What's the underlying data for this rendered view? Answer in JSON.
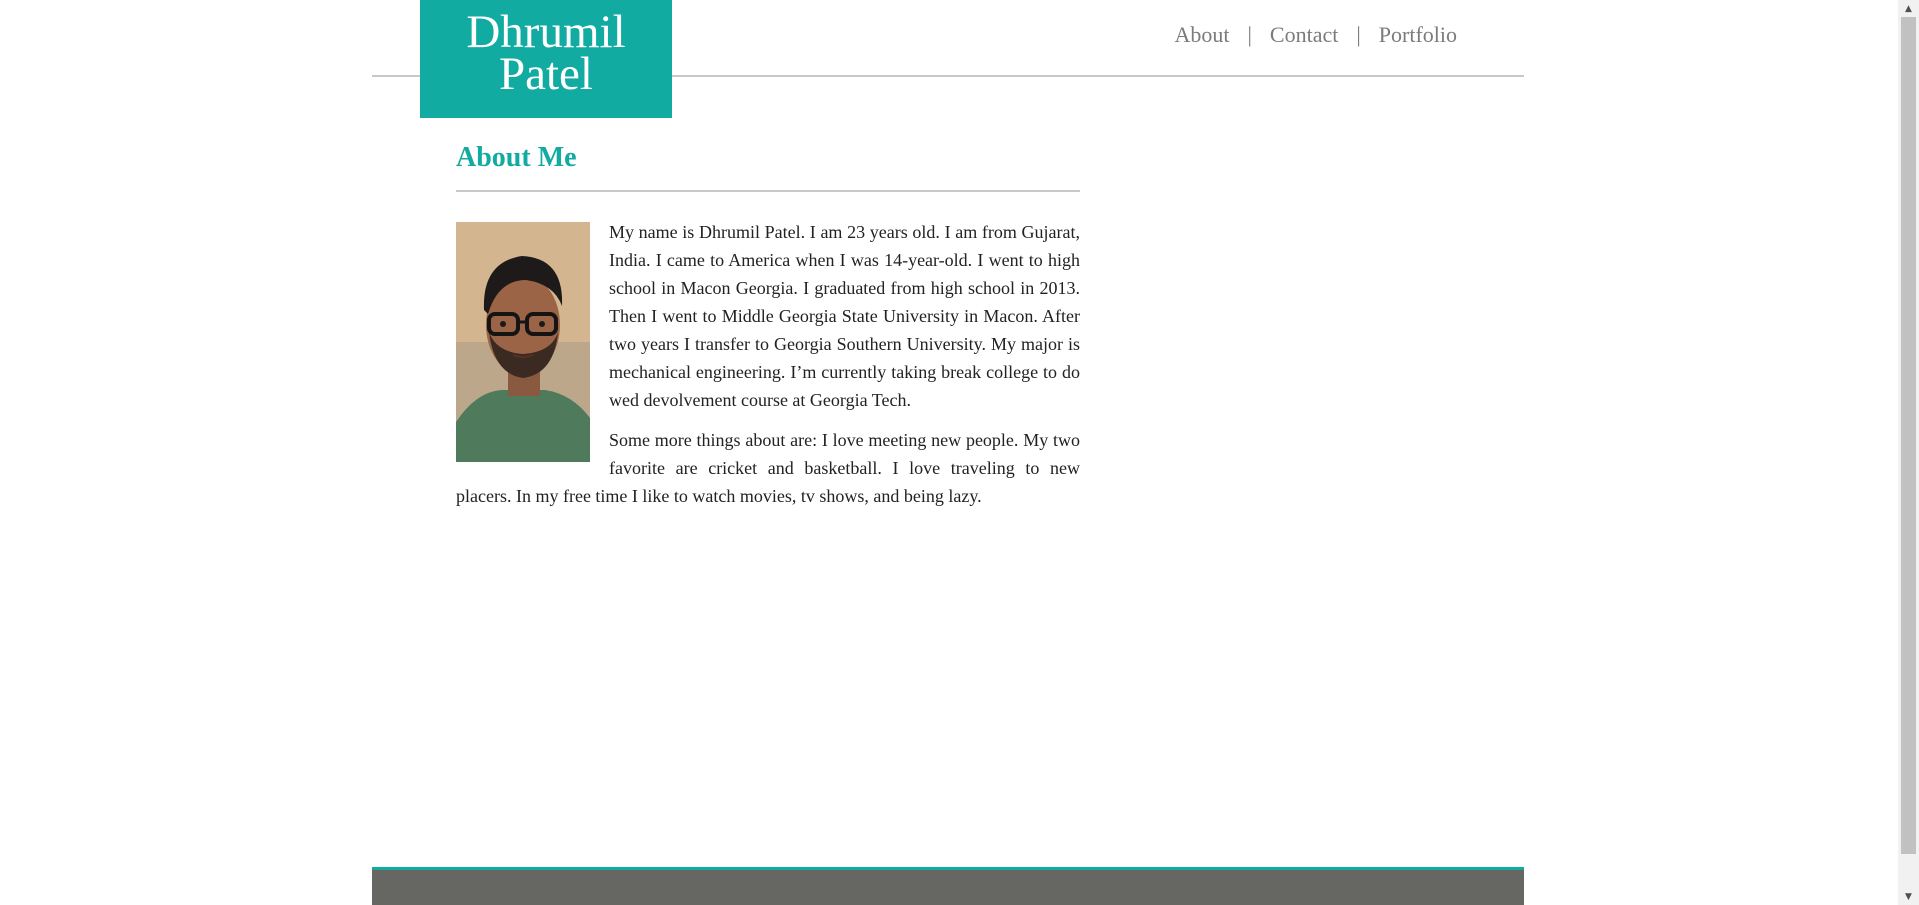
{
  "header": {
    "logo_text": "Dhrumil\nPatel",
    "nav": {
      "about": "About",
      "contact": "Contact",
      "portfolio": "Portfolio",
      "separator": "|"
    }
  },
  "main": {
    "heading": "About Me",
    "paragraph_1": "My name is Dhrumil Patel. I am 23 years old. I am from Gujarat, India. I came to America when I was 14-year-old. I went to high school in Macon Georgia. I graduated from high school in 2013. Then I went to Middle Georgia State University in Macon. After two years I transfer to Georgia Southern University. My major is mechanical engineering. I’m currently taking break college to do wed devolvement course at Georgia Tech.",
    "paragraph_2": "Some more things about are: I love meeting new people. My two favorite are cricket and basketball. I love traveling to new placers. In my free time I like to watch movies, tv shows, and being lazy."
  },
  "scrollbar": {
    "up_icon": "▲",
    "down_icon": "▼"
  },
  "colors": {
    "accent": "#12aba2",
    "footer": "#666662",
    "nav_text": "#7b7b7b",
    "body_text": "#222222"
  }
}
